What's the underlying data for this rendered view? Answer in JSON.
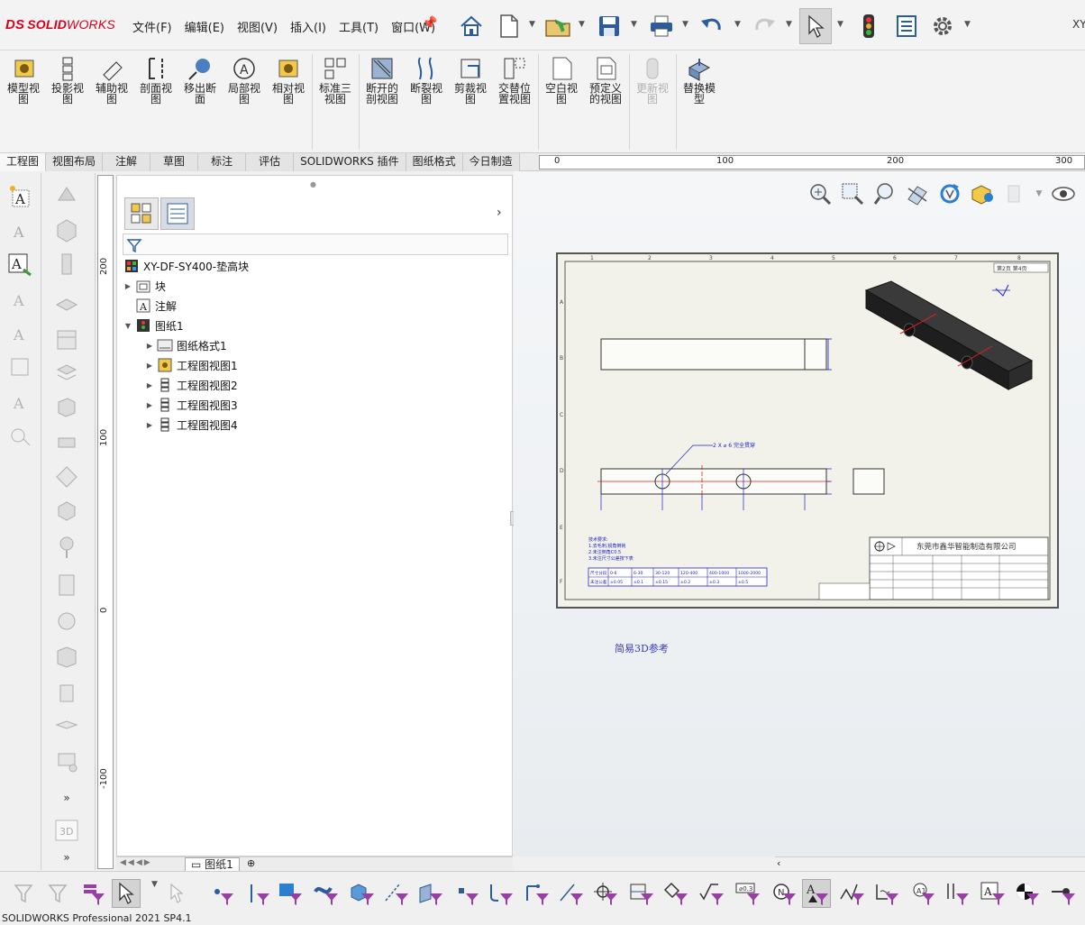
{
  "app": {
    "brand_ds": "DS",
    "brand_solid": "SOLID",
    "brand_works": "WORKS",
    "user_tag": "XY",
    "status": "SOLIDWORKS Professional 2021 SP4.1"
  },
  "menu": [
    "文件(F)",
    "编辑(E)",
    "视图(V)",
    "插入(I)",
    "工具(T)",
    "窗口(W)"
  ],
  "ribbon": {
    "items": [
      {
        "label": "模型视\n图"
      },
      {
        "label": "投影视\n图"
      },
      {
        "label": "辅助视\n图"
      },
      {
        "label": "剖面视\n图"
      },
      {
        "label": "移出断\n面"
      },
      {
        "label": "局部视\n图"
      },
      {
        "label": "相对视\n图"
      },
      {
        "label": "标准三\n视图"
      },
      {
        "label": "断开的\n剖视图"
      },
      {
        "label": "断裂视\n图"
      },
      {
        "label": "剪裁视\n图"
      },
      {
        "label": "交替位\n置视图"
      },
      {
        "label": "空白视\n图"
      },
      {
        "label": "预定义\n的视图"
      },
      {
        "label": "更新视\n图"
      },
      {
        "label": "替换模\n型"
      }
    ]
  },
  "tabs": [
    "工程图",
    "视图布局",
    "注解",
    "草图",
    "标注",
    "评估",
    "SOLIDWORKS 插件",
    "图纸格式",
    "今日制造"
  ],
  "ruler": {
    "h_ticks": [
      "0",
      "100",
      "200",
      "300"
    ],
    "v_ticks": [
      "200",
      "100",
      "0",
      "-100"
    ]
  },
  "tree": {
    "root": "XY-DF-SY400-垫高块",
    "items": [
      {
        "label": "块"
      },
      {
        "label": "注解"
      },
      {
        "label": "图纸1"
      },
      {
        "label": "图纸格式1"
      },
      {
        "label": "工程图视图1"
      },
      {
        "label": "工程图视图2"
      },
      {
        "label": "工程图视图3"
      },
      {
        "label": "工程图视图4"
      }
    ],
    "sheet_tab": "图纸1"
  },
  "drawing": {
    "company": "东莞市鑫华智能制造有限公司",
    "hole_note": "2 X ⌀ 6 完全贯穿",
    "ref_note": "简易3D参考",
    "top_label": "第2页 第4页",
    "tol_header": [
      "尺寸分段",
      "0-6",
      "6-30",
      "30-120",
      "120-400",
      "400-1000",
      "1000-2000"
    ],
    "tol_values": [
      "未注公差",
      "±0.05",
      "±0.1",
      "±0.15",
      "±0.2",
      "±0.3",
      "±0.5"
    ],
    "tech_req": [
      "技术要求:",
      "1.去毛刺,锐角倒钝",
      "2.未注倒角C0.5",
      "3.未注尺寸公差按下表"
    ],
    "border_nums": [
      "1",
      "2",
      "3",
      "4",
      "5",
      "6",
      "7",
      "8"
    ],
    "border_letters": [
      "A",
      "B",
      "C",
      "D",
      "E",
      "F"
    ]
  }
}
